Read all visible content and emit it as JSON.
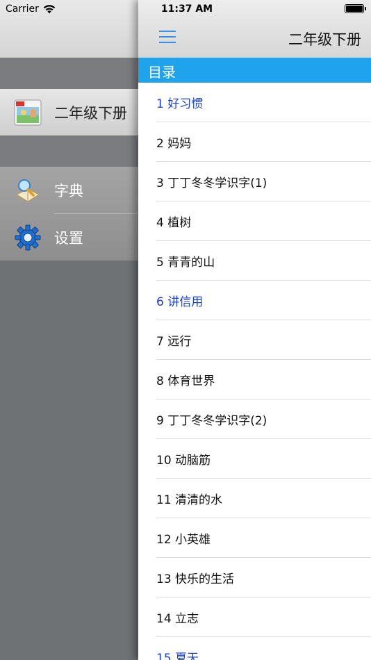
{
  "status": {
    "carrier": "Carrier",
    "time": "11:37 AM"
  },
  "drawer": {
    "book": {
      "label": "二年级下册",
      "icon": "book-cover-icon"
    },
    "menu": [
      {
        "label": "字典",
        "icon": "dictionary-icon"
      },
      {
        "label": "设置",
        "icon": "gear-icon"
      }
    ]
  },
  "header": {
    "title": "二年级下册",
    "menu_icon": "hamburger-menu-icon"
  },
  "section": {
    "title": "目录"
  },
  "lessons": [
    {
      "label": "1 好习惯",
      "highlight": true
    },
    {
      "label": "2 妈妈",
      "highlight": false
    },
    {
      "label": "3 丁丁冬冬学识字(1)",
      "highlight": false
    },
    {
      "label": "4 植树",
      "highlight": false
    },
    {
      "label": "5 青青的山",
      "highlight": false
    },
    {
      "label": "6 讲信用",
      "highlight": true
    },
    {
      "label": "7 远行",
      "highlight": false
    },
    {
      "label": "8 体育世界",
      "highlight": false
    },
    {
      "label": "9 丁丁冬冬学识字(2)",
      "highlight": false
    },
    {
      "label": "10 动脑筋",
      "highlight": false
    },
    {
      "label": "11 清清的水",
      "highlight": false
    },
    {
      "label": "12 小英雄",
      "highlight": false
    },
    {
      "label": "13 快乐的生活",
      "highlight": false
    },
    {
      "label": "14 立志",
      "highlight": false
    },
    {
      "label": "15 夏天",
      "highlight": true
    }
  ],
  "colors": {
    "accent": "#1fa3ec",
    "highlight_text": "#1a3fd6"
  }
}
